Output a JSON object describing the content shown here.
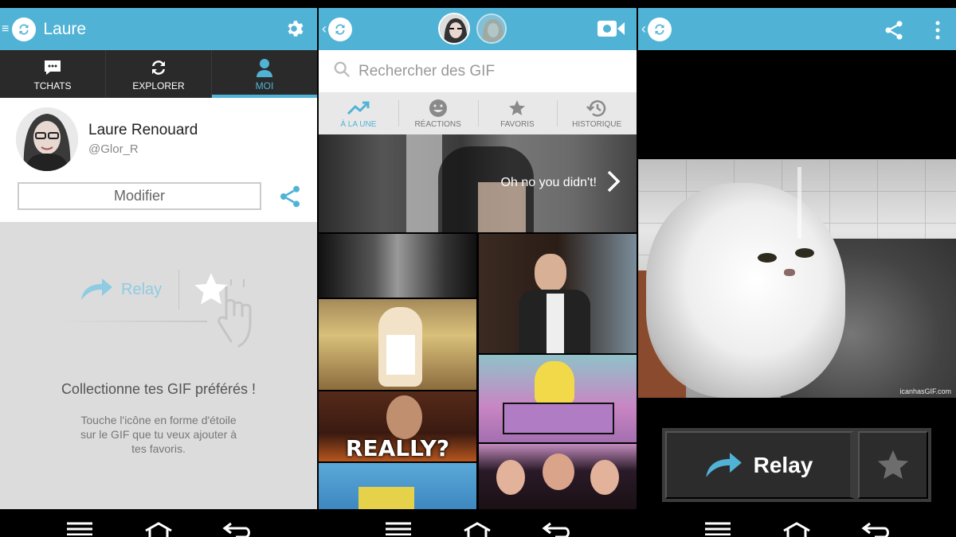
{
  "colors": {
    "accent": "#50b3d6",
    "tab_bar": "#2a2a2a"
  },
  "screen_profile": {
    "title": "Laure",
    "tabs": [
      {
        "label": "TCHATS",
        "icon": "chat-icon"
      },
      {
        "label": "EXPLORER",
        "icon": "refresh-icon"
      },
      {
        "label": "MOI",
        "icon": "person-icon",
        "active": true
      }
    ],
    "user": {
      "name": "Laure Renouard",
      "handle": "@Glor_R"
    },
    "edit_label": "Modifier",
    "ghost_relay_label": "Relay",
    "empty_title": "Collectionne tes GIF préférés !",
    "empty_sub": "Touche l'icône en forme d'étoile sur le GIF que tu veux ajouter à tes favoris."
  },
  "screen_browse": {
    "search_placeholder": "Rechercher des GIF",
    "categories": [
      {
        "label": "À LA UNE",
        "icon": "trending-icon",
        "active": true
      },
      {
        "label": "RÉACTIONS",
        "icon": "smiley-icon"
      },
      {
        "label": "FAVORIS",
        "icon": "star-icon"
      },
      {
        "label": "HISTORIQUE",
        "icon": "history-icon"
      }
    ],
    "featured_caption": "Oh no you didn't!",
    "gif_caption_really": "REALLY?"
  },
  "screen_view": {
    "relay_label": "Relay",
    "watermark": "icanhasGIF.com"
  }
}
